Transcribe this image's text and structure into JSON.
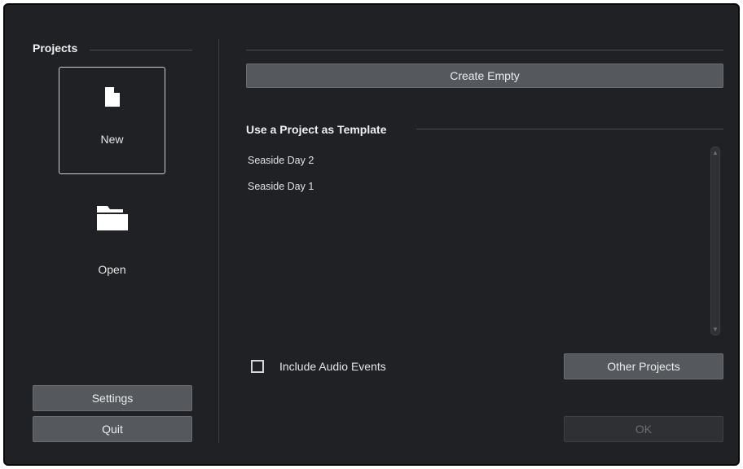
{
  "projects_section": {
    "title": "Projects"
  },
  "tiles": {
    "new": {
      "label": "New",
      "icon": "file-icon"
    },
    "open": {
      "label": "Open",
      "icon": "folder-icon"
    }
  },
  "left_buttons": {
    "settings": "Settings",
    "quit": "Quit"
  },
  "main": {
    "create_empty": "Create Empty",
    "template_title": "Use a Project as Template",
    "templates": [
      "Seaside Day 2",
      "Seaside Day 1"
    ],
    "include_audio_label": "Include Audio Events",
    "include_audio_checked": false,
    "other_projects": "Other Projects",
    "ok": "OK",
    "ok_enabled": false
  }
}
